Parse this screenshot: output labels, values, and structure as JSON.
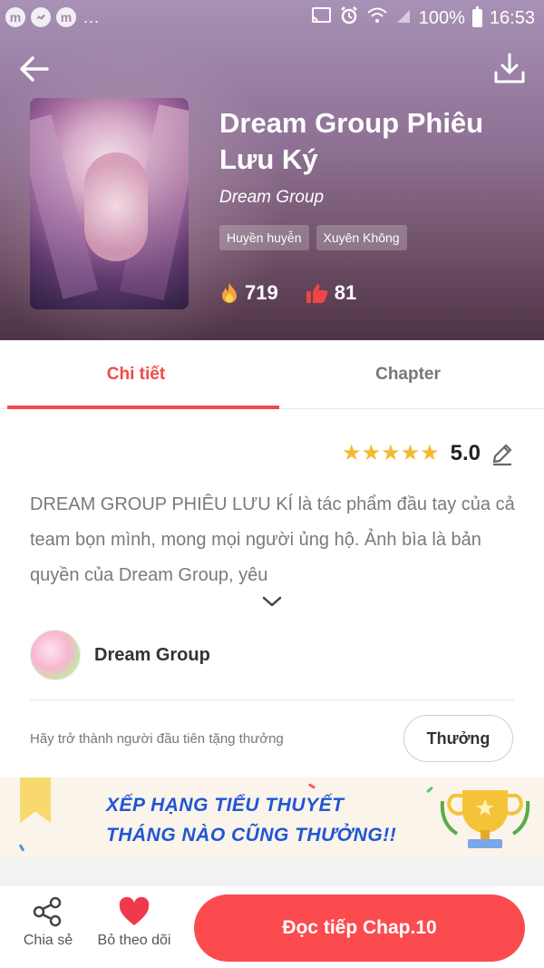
{
  "status_bar": {
    "app_icons": [
      "m",
      "messenger",
      "m"
    ],
    "dots": "...",
    "battery_text": "100%",
    "time": "16:53"
  },
  "book": {
    "title": "Dream Group Phiêu Lưu Ký",
    "author": "Dream Group",
    "tags": [
      "Huyền huyễn",
      "Xuyên Không"
    ],
    "views": "719",
    "likes": "81"
  },
  "tabs": [
    {
      "label": "Chi tiết",
      "active": true
    },
    {
      "label": "Chapter",
      "active": false
    }
  ],
  "rating": {
    "stars": 5,
    "value": "5.0"
  },
  "description": "DREAM GROUP PHIÊU LƯU KÍ là tác phẩm đầu tay của cả team bọn mình, mong mọi người ủng hộ. Ảnh bìa là bản quyền của Dream Group, yêu",
  "uploader": {
    "name": "Dream Group"
  },
  "gift": {
    "text": "Hãy trở thành người đầu tiên tặng thưởng",
    "button_label": "Thưởng"
  },
  "banner": {
    "line1": "XẾP HẠNG TIỂU THUYẾT",
    "line2": "THÁNG NÀO CŨNG THƯỞNG!!"
  },
  "bottom_bar": {
    "share_label": "Chia sẻ",
    "follow_label": "Bỏ theo dõi",
    "read_label": "Đọc tiếp Chap.10"
  },
  "colors": {
    "accent": "#f24a4a",
    "read_button": "#fb4b4e",
    "star": "#f5b82e",
    "banner_text": "#1f56d6"
  }
}
